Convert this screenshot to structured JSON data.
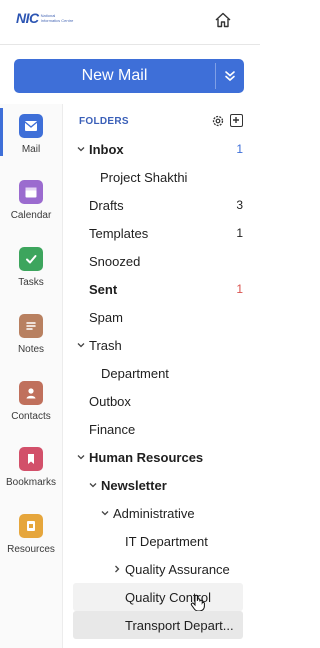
{
  "header": {
    "logo_text": "NIC",
    "logo_subtext": "National Informatics Centre",
    "home_icon": "home-icon"
  },
  "new_mail": {
    "label": "New Mail",
    "dropdown_icon": "double-chevron-down-icon"
  },
  "rail": [
    {
      "label": "Mail",
      "icon": "mail-icon",
      "color": "#3e6fd8"
    },
    {
      "label": "Calendar",
      "icon": "calendar-icon",
      "color": "#9b6bcf"
    },
    {
      "label": "Tasks",
      "icon": "check-icon",
      "color": "#3da55d"
    },
    {
      "label": "Notes",
      "icon": "notes-icon",
      "color": "#b88060"
    },
    {
      "label": "Contacts",
      "icon": "contact-icon",
      "color": "#c0705c"
    },
    {
      "label": "Bookmarks",
      "icon": "bookmark-icon",
      "color": "#d2506a"
    },
    {
      "label": "Resources",
      "icon": "resources-icon",
      "color": "#e6a63c"
    }
  ],
  "folders": {
    "heading": "FOLDERS",
    "items": [
      {
        "label": "Inbox",
        "count": "1",
        "count_color": "#3e6fd8"
      },
      {
        "label": "Project Shakthi",
        "count": ""
      },
      {
        "label": "Drafts",
        "count": "3",
        "count_color": "#222222"
      },
      {
        "label": "Templates",
        "count": "1",
        "count_color": "#222222"
      },
      {
        "label": "Snoozed",
        "count": ""
      },
      {
        "label": "Sent",
        "count": "1",
        "count_color": "#d9534f"
      },
      {
        "label": "Spam",
        "count": ""
      },
      {
        "label": "Trash",
        "count": ""
      },
      {
        "label": "Department",
        "count": ""
      },
      {
        "label": "Outbox",
        "count": ""
      },
      {
        "label": "Finance",
        "count": ""
      },
      {
        "label": "Human Resources",
        "count": ""
      },
      {
        "label": "Newsletter",
        "count": ""
      },
      {
        "label": "Administrative",
        "count": ""
      },
      {
        "label": "IT Department",
        "count": ""
      },
      {
        "label": "Quality Assurance",
        "count": ""
      },
      {
        "label": "Quality Control",
        "count": ""
      },
      {
        "label": "Transport Depart...",
        "count": ""
      }
    ]
  }
}
